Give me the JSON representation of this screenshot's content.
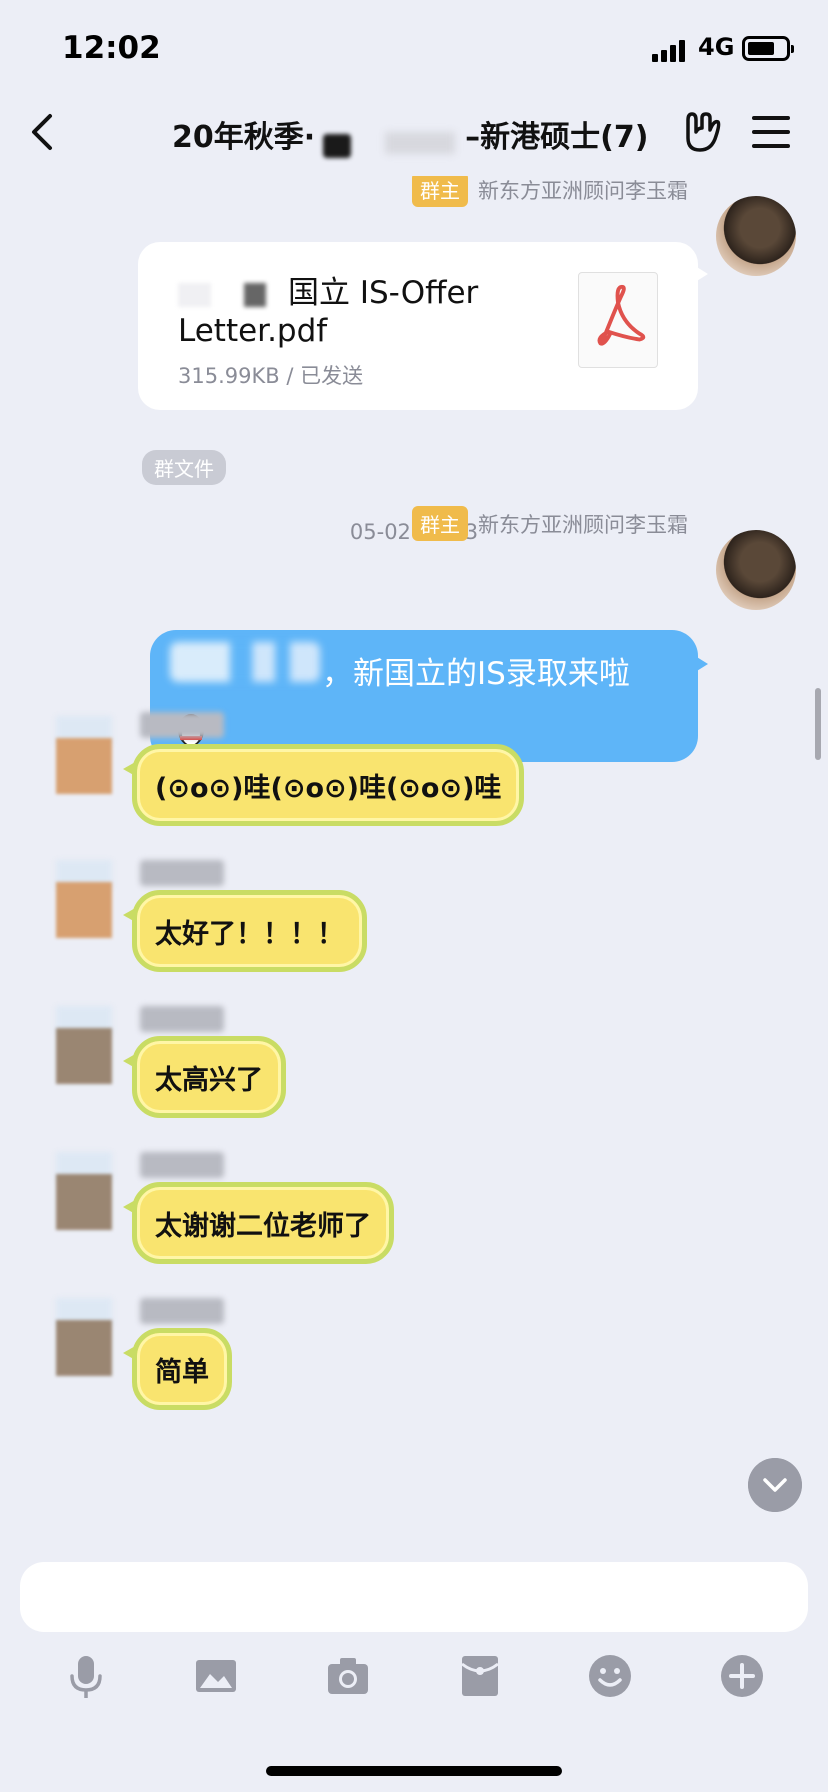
{
  "status_bar": {
    "time": "12:02",
    "network": "4G"
  },
  "header": {
    "title_prefix": "20年秋季·",
    "title_suffix": "–新港硕士(7)"
  },
  "messages": {
    "owner_badge": "群主",
    "sender_name": "新东方亚洲顾问李玉霜",
    "file": {
      "name_visible": "国立 IS-Offer Letter.pdf",
      "name_line1": "国立 IS-Offer",
      "name_line2": "Letter.pdf",
      "meta": "315.99KB / 已发送"
    },
    "group_file_tag": "群文件",
    "timestamp": "05-02 12:23",
    "blue_text": "，新国立的IS录取来啦",
    "replies": [
      {
        "text": "(⊙o⊙)哇(⊙o⊙)哇(⊙o⊙)哇"
      },
      {
        "text": "太好了！！！！"
      },
      {
        "text": "太高兴了"
      },
      {
        "text": "太谢谢二位老师了"
      },
      {
        "text": "简单"
      }
    ]
  },
  "colors": {
    "background": "#eceef6",
    "owner_badge": "#f0bb4b",
    "blue_bubble": "#5eb5f8",
    "lemon_bubble": "#f9e46f",
    "lemon_border": "#c9dc64"
  },
  "toolbar_icons": [
    "microphone-icon",
    "image-icon",
    "camera-icon",
    "red-packet-icon",
    "emoji-icon",
    "plus-icon"
  ]
}
